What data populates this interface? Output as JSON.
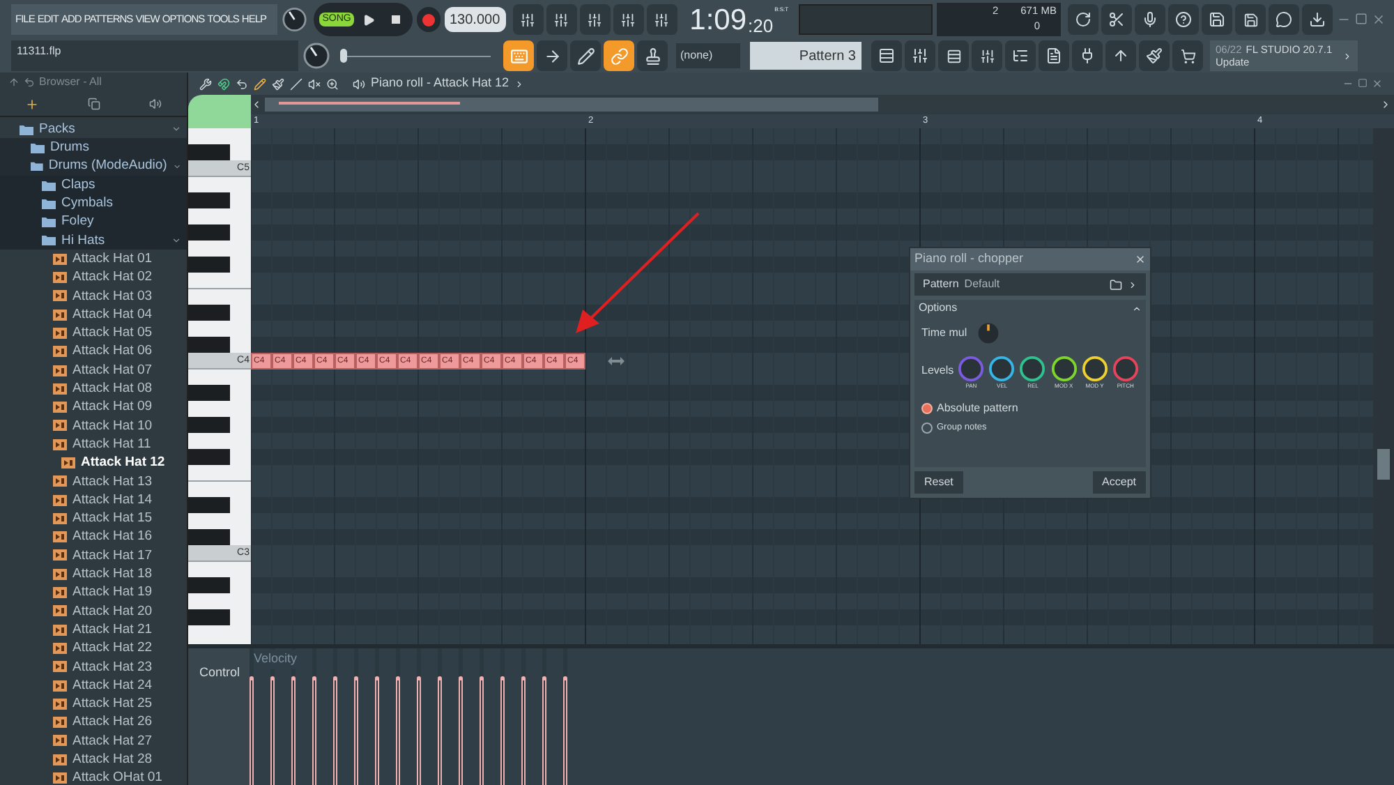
{
  "menu": [
    "FILE",
    "EDIT",
    "ADD",
    "PATTERNS",
    "VIEW",
    "OPTIONS",
    "TOOLS",
    "HELP"
  ],
  "project_file": "11311.flp",
  "transport": {
    "mode": "SONG",
    "song_on": true
  },
  "tempo": "130.000",
  "time": {
    "main": "1:09",
    "sub": ":20",
    "units": "B:S:T"
  },
  "position": {
    "level": 0
  },
  "cpu": {
    "voices": "2",
    "memory": "671 MB",
    "polyphony": "0"
  },
  "tool_buttons": [
    {
      "kind": "typing",
      "on": true
    },
    {
      "kind": "arrow",
      "on": false
    },
    {
      "kind": "step",
      "on": false
    },
    {
      "kind": "link",
      "on": true
    },
    {
      "kind": "stamp",
      "on": false
    }
  ],
  "snap": "(none)",
  "pattern": "Pattern 3",
  "hint": {
    "date": "06/22",
    "text": "FL STUDIO 20.7.1",
    "action": "Update"
  },
  "browser": {
    "path": "Browser - All",
    "tree": [
      {
        "label": "Packs",
        "kind": "folder",
        "expanded": true,
        "selected": false,
        "children": [
          {
            "label": "Drums",
            "kind": "folder",
            "expanded": false,
            "selected": false
          },
          {
            "label": "Drums (ModeAudio)",
            "kind": "folder",
            "expanded": true,
            "selected": false,
            "children": [
              {
                "label": "Claps",
                "kind": "folder",
                "expanded": false,
                "selected": false
              },
              {
                "label": "Cymbals",
                "kind": "folder",
                "expanded": false,
                "selected": false
              },
              {
                "label": "Foley",
                "kind": "folder",
                "expanded": false,
                "selected": false
              },
              {
                "label": "Hi Hats",
                "kind": "folder",
                "expanded": true,
                "selected": false,
                "children": [
                  {
                    "label": "Attack Hat 01",
                    "kind": "file",
                    "selected": false
                  },
                  {
                    "label": "Attack Hat 02",
                    "kind": "file",
                    "selected": false
                  },
                  {
                    "label": "Attack Hat 03",
                    "kind": "file",
                    "selected": false
                  },
                  {
                    "label": "Attack Hat 04",
                    "kind": "file",
                    "selected": false
                  },
                  {
                    "label": "Attack Hat 05",
                    "kind": "file",
                    "selected": false
                  },
                  {
                    "label": "Attack Hat 06",
                    "kind": "file",
                    "selected": false
                  },
                  {
                    "label": "Attack Hat 07",
                    "kind": "file",
                    "selected": false
                  },
                  {
                    "label": "Attack Hat 08",
                    "kind": "file",
                    "selected": false
                  },
                  {
                    "label": "Attack Hat 09",
                    "kind": "file",
                    "selected": false
                  },
                  {
                    "label": "Attack Hat 10",
                    "kind": "file",
                    "selected": false
                  },
                  {
                    "label": "Attack Hat 11",
                    "kind": "file",
                    "selected": false
                  },
                  {
                    "label": "Attack Hat 12",
                    "kind": "file",
                    "selected": true
                  },
                  {
                    "label": "Attack Hat 13",
                    "kind": "file",
                    "selected": false
                  },
                  {
                    "label": "Attack Hat 14",
                    "kind": "file",
                    "selected": false
                  },
                  {
                    "label": "Attack Hat 15",
                    "kind": "file",
                    "selected": false
                  },
                  {
                    "label": "Attack Hat 16",
                    "kind": "file",
                    "selected": false
                  },
                  {
                    "label": "Attack Hat 17",
                    "kind": "file",
                    "selected": false
                  },
                  {
                    "label": "Attack Hat 18",
                    "kind": "file",
                    "selected": false
                  },
                  {
                    "label": "Attack Hat 19",
                    "kind": "file",
                    "selected": false
                  },
                  {
                    "label": "Attack Hat 20",
                    "kind": "file",
                    "selected": false
                  },
                  {
                    "label": "Attack Hat 21",
                    "kind": "file",
                    "selected": false
                  },
                  {
                    "label": "Attack Hat 22",
                    "kind": "file",
                    "selected": false
                  },
                  {
                    "label": "Attack Hat 23",
                    "kind": "file",
                    "selected": false
                  },
                  {
                    "label": "Attack Hat 24",
                    "kind": "file",
                    "selected": false
                  },
                  {
                    "label": "Attack Hat 25",
                    "kind": "file",
                    "selected": false
                  },
                  {
                    "label": "Attack Hat 26",
                    "kind": "file",
                    "selected": false
                  },
                  {
                    "label": "Attack Hat 27",
                    "kind": "file",
                    "selected": false
                  },
                  {
                    "label": "Attack Hat 28",
                    "kind": "file",
                    "selected": false
                  },
                  {
                    "label": "Attack OHat 01",
                    "kind": "file",
                    "selected": false
                  }
                ]
              }
            ]
          }
        ]
      }
    ]
  },
  "piano_roll": {
    "title": "Piano roll - Attack Hat 12",
    "bars": [
      "1",
      "2",
      "3",
      "4"
    ],
    "key_labels": [
      "C5",
      "C4",
      "C3"
    ],
    "notes": [
      {
        "label": "C4",
        "level": 0.8
      },
      {
        "label": "C4",
        "level": 0.8
      },
      {
        "label": "C4",
        "level": 0.8
      },
      {
        "label": "C4",
        "level": 0.8
      },
      {
        "label": "C4",
        "level": 0.8
      },
      {
        "label": "C4",
        "level": 0.8
      },
      {
        "label": "C4",
        "level": 0.8
      },
      {
        "label": "C4",
        "level": 0.8
      },
      {
        "label": "C4",
        "level": 0.8
      },
      {
        "label": "C4",
        "level": 0.8
      },
      {
        "label": "C4",
        "level": 0.8
      },
      {
        "label": "C4",
        "level": 0.8
      },
      {
        "label": "C4",
        "level": 0.8
      },
      {
        "label": "C4",
        "level": 0.8
      },
      {
        "label": "C4",
        "level": 0.8
      },
      {
        "label": "C4",
        "level": 0.8
      }
    ],
    "control": "Control",
    "control_target": "Velocity"
  },
  "chopper": {
    "title": "Piano roll - chopper",
    "pattern_label": "Pattern",
    "pattern_value": "Default",
    "section": "Options",
    "expanded": true,
    "time_mul": "Time mul",
    "levels_label": "Levels",
    "knobs": [
      {
        "label": "PAN",
        "color": "#7b5ce0"
      },
      {
        "label": "VEL",
        "color": "#35b6e6"
      },
      {
        "label": "REL",
        "color": "#2fc28e"
      },
      {
        "label": "MOD X",
        "color": "#7fd62a"
      },
      {
        "label": "MOD Y",
        "color": "#f0d02e"
      },
      {
        "label": "PITCH",
        "color": "#e5445a"
      }
    ],
    "options": [
      {
        "label": "Absolute pattern",
        "checked": true
      },
      {
        "label": "Group notes",
        "checked": false
      }
    ],
    "buttons": [
      "Reset",
      "Accept"
    ]
  }
}
